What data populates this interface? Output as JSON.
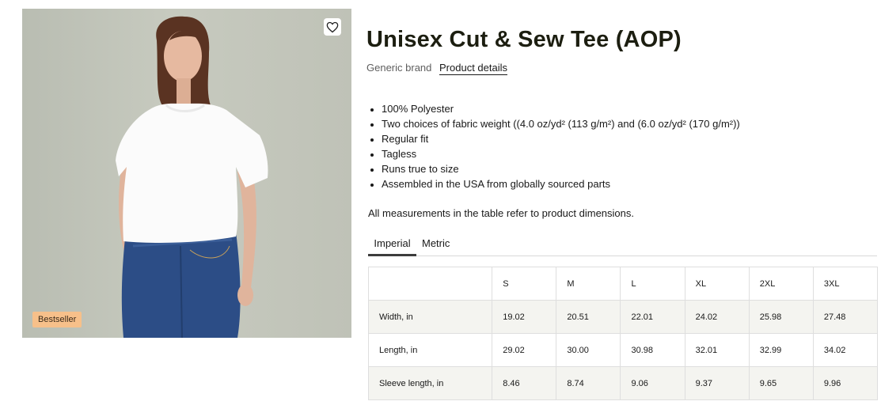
{
  "product": {
    "title": "Unisex Cut & Sew Tee (AOP)",
    "brand": "Generic brand",
    "details_link": "Product details",
    "badge": "Bestseller",
    "image_alt": "Woman wearing white t-shirt and blue jeans",
    "features": [
      "100% Polyester",
      "Two choices of fabric weight ((4.0 oz/yd² (113 g/m²) and (6.0 oz/yd² (170 g/m²))",
      "Regular fit",
      "Tagless",
      "Runs true to size",
      "Assembled in the USA from globally sourced parts"
    ],
    "measurement_note": "All measurements in the table refer to product dimensions."
  },
  "tabs": {
    "imperial": "Imperial",
    "metric": "Metric",
    "selected": "Imperial"
  },
  "size_table": {
    "header": [
      "",
      "S",
      "M",
      "L",
      "XL",
      "2XL",
      "3XL"
    ],
    "rows": [
      [
        "Width, in",
        "19.02",
        "20.51",
        "22.01",
        "24.02",
        "25.98",
        "27.48"
      ],
      [
        "Length, in",
        "29.02",
        "30.00",
        "30.98",
        "32.01",
        "32.99",
        "34.02"
      ],
      [
        "Sleeve length, in",
        "8.46",
        "8.74",
        "9.06",
        "9.37",
        "9.65",
        "9.96"
      ]
    ]
  },
  "colors": {
    "badge": "#f7c08a",
    "title": "#1c1e10",
    "row_shade": "#f4f4f0"
  },
  "icons": {
    "favorite": "heart-outline-icon"
  }
}
